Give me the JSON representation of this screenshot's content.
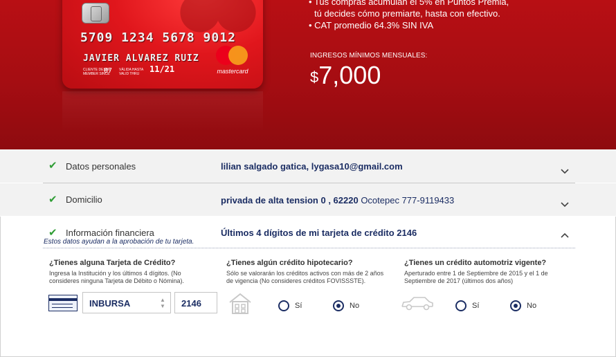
{
  "hero": {
    "card": {
      "number": "5709 1234 5678 9012",
      "holder": "JAVIER ALVAREZ RUIZ",
      "member_since_label": "CLIENTE DESDE MEMBER SINCE",
      "member_since": "07",
      "valid_thru_label": "VÁLIDA HASTA VALID THRU",
      "valid_thru": "11/21",
      "brand": "mastercard"
    },
    "benefits": {
      "line1": "• Tus compras acumulan el 5% en Puntos Premia,",
      "line2": "tú decides cómo premiarte, hasta con efectivo.",
      "line3": "• CAT promedio 64.3% SIN IVA"
    },
    "income_label": "INGRESOS MÍNIMOS MENSUALES:",
    "income_currency": "$",
    "income_value": "7,000"
  },
  "sections": {
    "personal": {
      "title": "Datos personales",
      "value": "lilian salgado gatica, lygasa10@gmail.com"
    },
    "address": {
      "title": "Domicilio",
      "value": "privada de alta tension 0 , 62220",
      "value_suffix": " Ocotepec 777-9119433"
    },
    "financial": {
      "title": "Información financiera",
      "value": "Últimos 4 dígitos de mi tarjeta de crédito 2146",
      "note": "Estos datos ayudan a la aprobación de tu tarjeta."
    }
  },
  "questions": {
    "credit_card": {
      "title": "¿Tienes alguna Tarjeta de Crédito?",
      "desc1": "Ingresa la Institución y los últimos 4 dígitos. (No",
      "desc2": "consideres ninguna Tarjeta de Débito o Nómina).",
      "institution": "INBURSA",
      "last_digits": "2146"
    },
    "mortgage": {
      "title": "¿Tienes algún crédito hipotecario?",
      "desc1": "Sólo se valorarán los créditos activos con más de 2 años",
      "desc2": "de vigencia (No consideres créditos FOVISSSTE).",
      "yes_label": "Sí",
      "no_label": "No",
      "selected": "No"
    },
    "auto": {
      "title": "¿Tienes un crédito automotriz vigente?",
      "desc1": "Aperturado entre 1 de Septiembre de 2015 y el 1 de",
      "desc2": "Septiembre de 2017 (últimos dos años)",
      "yes_label": "Sí",
      "no_label": "No",
      "selected": "No"
    }
  },
  "colors": {
    "brand_red": "#b80f14",
    "navy": "#1b2d63",
    "check_green": "#2f9d35"
  }
}
